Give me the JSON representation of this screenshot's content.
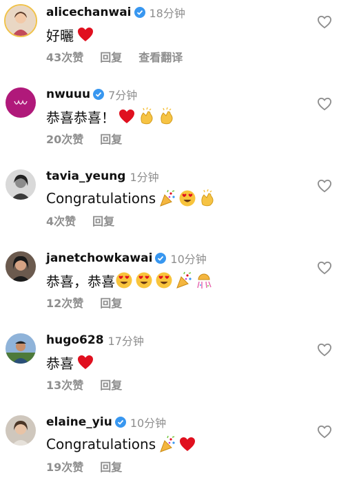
{
  "comments": [
    {
      "username": "alicechanwai",
      "verified": true,
      "time": "18分钟",
      "text": "好曬",
      "emojis": [
        "heart"
      ],
      "likes": "43次赞",
      "reply": "回复",
      "translate": "查看翻译"
    },
    {
      "username": "nwuuu",
      "verified": true,
      "time": "7分钟",
      "text": "恭喜恭喜！",
      "emojis": [
        "heart",
        "clap",
        "clap"
      ],
      "likes": "20次赞",
      "reply": "回复"
    },
    {
      "username": "tavia_yeung",
      "verified": false,
      "time": "1分钟",
      "text": "Congratulations",
      "emojis": [
        "party",
        "heart-eyes",
        "clap"
      ],
      "likes": "4次赞",
      "reply": "回复"
    },
    {
      "username": "janetchowkawai",
      "verified": true,
      "time": "10分钟",
      "text": "恭喜，恭喜",
      "emojis": [
        "heart-eyes",
        "heart-eyes",
        "heart-eyes",
        "party",
        "confetti"
      ],
      "likes": "12次赞",
      "reply": "回复"
    },
    {
      "username": "hugo628",
      "verified": false,
      "time": "17分钟",
      "text": "恭喜",
      "emojis": [
        "heart"
      ],
      "likes": "13次赞",
      "reply": "回复"
    },
    {
      "username": "elaine_yiu",
      "verified": true,
      "time": "10分钟",
      "text": "Congratulations",
      "emojis": [
        "party",
        "heart"
      ],
      "likes": "19次赞",
      "reply": "回复"
    }
  ],
  "colors": {
    "verified": "#3897f0",
    "muted": "#8e8e8e",
    "heart": "#e0101f"
  }
}
